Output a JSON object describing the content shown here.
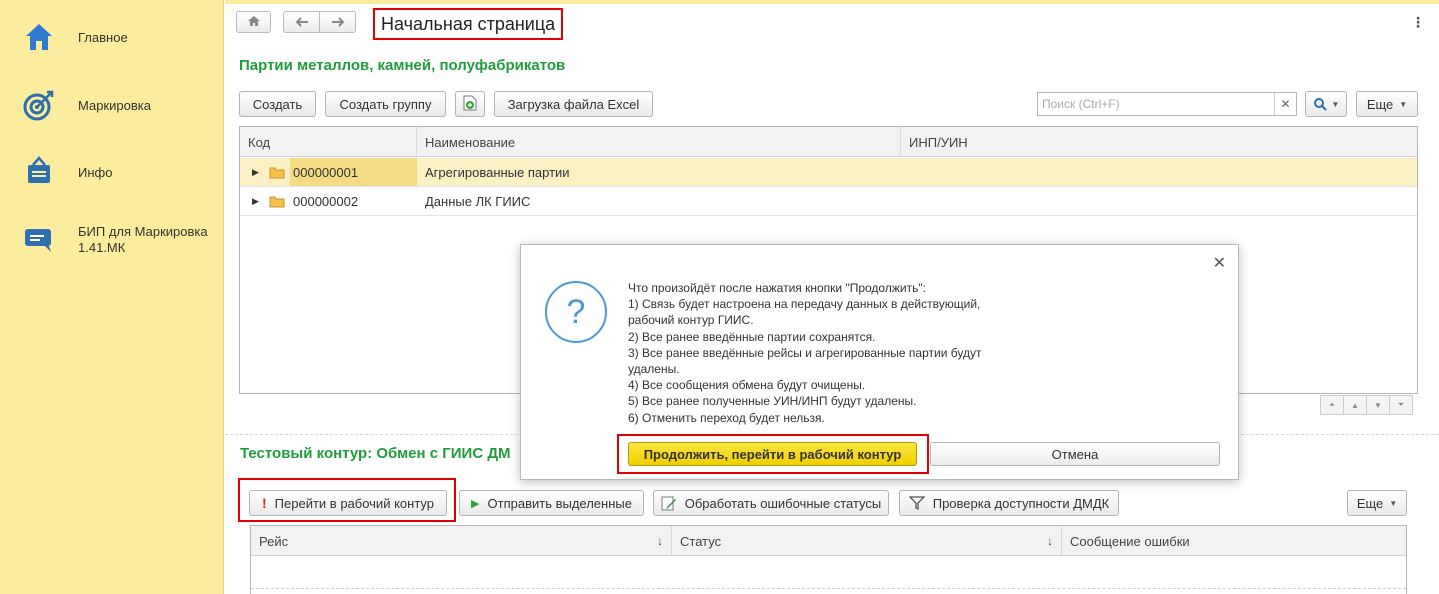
{
  "sidebar": {
    "items": [
      {
        "label": "Главное",
        "icon": "home-icon"
      },
      {
        "label": "Маркировка",
        "icon": "target-icon"
      },
      {
        "label": "Инфо",
        "icon": "info-box-icon"
      },
      {
        "label": "БИП для Маркировка 1.41.МК",
        "icon": "chat-icon"
      }
    ]
  },
  "header": {
    "title": "Начальная страница",
    "more": "⋮"
  },
  "section1": {
    "title": "Партии металлов, камней, полуфабрикатов",
    "buttons": {
      "create": "Создать",
      "create_group": "Создать группу",
      "load_excel": "Загрузка файла Excel",
      "more": "Еще"
    },
    "search": {
      "placeholder": "Поиск (Ctrl+F)",
      "value": ""
    },
    "columns": [
      "Код",
      "Наименование",
      "ИНП/УИН"
    ],
    "rows": [
      {
        "code": "000000001",
        "name": "Агрегированные партии",
        "inp": ""
      },
      {
        "code": "000000002",
        "name": "Данные ЛК ГИИС",
        "inp": ""
      }
    ]
  },
  "section2": {
    "title": "Тестовый контур: Обмен с ГИИС ДМ",
    "buttons": {
      "go_work": "Перейти в рабочий контур",
      "send_selected": "Отправить выделенные",
      "process_errors": "Обработать ошибочные статусы",
      "check_dmdk": "Проверка доступности ДМДК",
      "more": "Еще"
    },
    "columns": [
      "Рейс",
      "Статус",
      "Сообщение ошибки"
    ]
  },
  "dialog": {
    "lines": [
      "Что произойдёт после нажатия кнопки \"Продолжить\":",
      "1) Связь будет настроена на передачу данных в действующий,",
      "рабочий контур ГИИС.",
      "2) Все ранее введённые партии сохранятся.",
      "3) Все ранее введённые рейсы и агрегированные партии будут",
      "удалены.",
      "4) Все сообщения обмена будут очищены.",
      "5) Все ранее полученные УИН/ИНП будут удалены.",
      "6) Отменить переход будет нельзя."
    ],
    "continue_button": "Продолжить, перейти в рабочий контур",
    "cancel_button": "Отмена"
  },
  "colors": {
    "sidebar_bg": "#fbec9e",
    "section_title": "#1f9c3c",
    "highlight": "#e00000",
    "primary_button": "#f5d80e",
    "selected_row": "#fbefc4"
  }
}
